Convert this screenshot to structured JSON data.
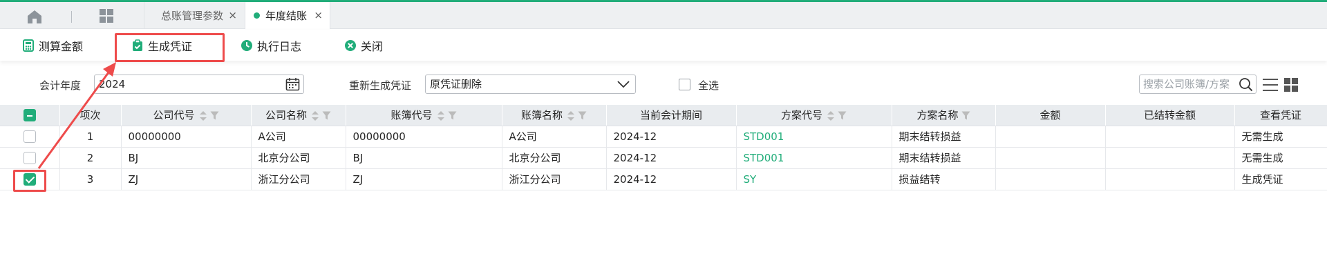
{
  "tabs": {
    "inactive_label": "总账管理参数",
    "active_label": "年度结账",
    "close_glyph": "×"
  },
  "toolbar": {
    "calc_label": "测算金额",
    "generate_label": "生成凭证",
    "log_label": "执行日志",
    "close_label": "关闭"
  },
  "filters": {
    "year_label": "会计年度",
    "year_value": "2024",
    "regen_label": "重新生成凭证",
    "regen_value": "原凭证删除",
    "select_all_label": "全选",
    "search_placeholder": "搜索公司账簿/方案"
  },
  "table": {
    "headers": [
      "项次",
      "公司代号",
      "公司名称",
      "账簿代号",
      "账簿名称",
      "当前会计期间",
      "方案代号",
      "方案名称",
      "金额",
      "已结转金额",
      "查看凭证"
    ],
    "rows": [
      {
        "idx": "1",
        "company_code": "00000000",
        "company_name": "A公司",
        "book_code": "00000000",
        "book_name": "A公司",
        "period": "2024-12",
        "plan_code": "STD001",
        "plan_name": "期末结转损益",
        "amount": "",
        "carried": "",
        "voucher": "无需生成",
        "checked": false
      },
      {
        "idx": "2",
        "company_code": "BJ",
        "company_name": "北京分公司",
        "book_code": "BJ",
        "book_name": "北京分公司",
        "period": "2024-12",
        "plan_code": "STD001",
        "plan_name": "期末结转损益",
        "amount": "",
        "carried": "",
        "voucher": "无需生成",
        "checked": false
      },
      {
        "idx": "3",
        "company_code": "ZJ",
        "company_name": "浙江分公司",
        "book_code": "ZJ",
        "book_name": "浙江分公司",
        "period": "2024-12",
        "plan_code": "SY",
        "plan_name": "损益结转",
        "amount": "",
        "carried": "",
        "voucher": "生成凭证",
        "checked": true
      }
    ]
  },
  "colors": {
    "accent": "#21ad7a",
    "highlight": "#ee4b4b"
  }
}
